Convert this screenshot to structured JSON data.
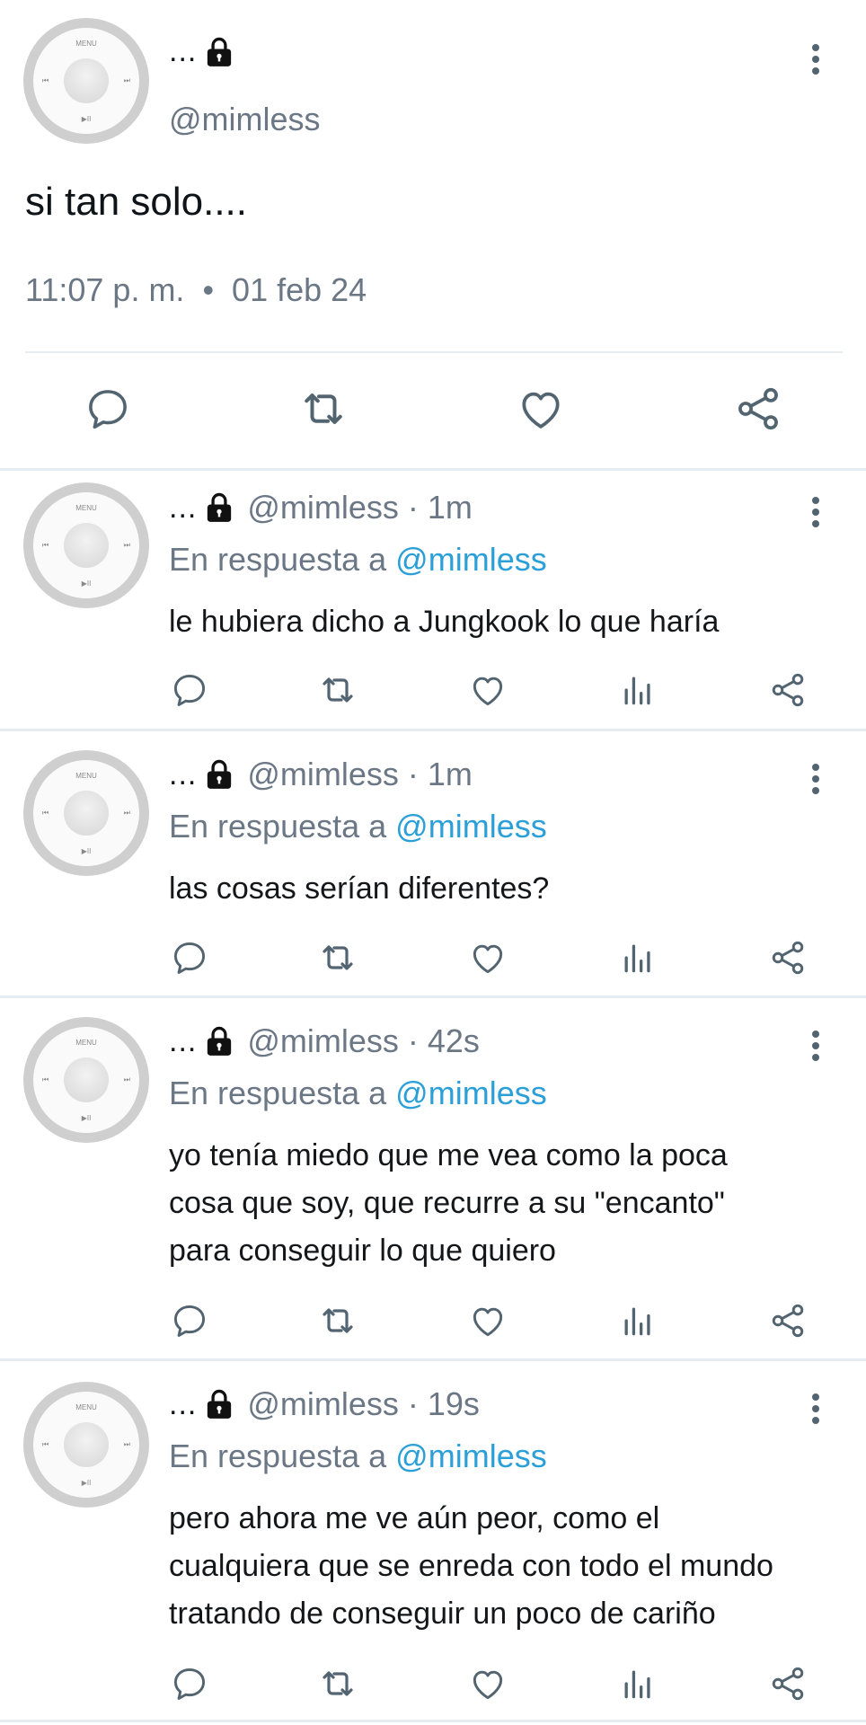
{
  "avatar_labels": {
    "menu": "MENU",
    "prev": "⏮",
    "next": "⏭",
    "play": "▶II"
  },
  "main_tweet": {
    "name": "...",
    "handle": "@mimless",
    "text": "si tan solo....",
    "time": "11:07 p. m.",
    "separator": "•",
    "date": "01 feb 24"
  },
  "replies": [
    {
      "name": "...",
      "handle_meta": "@mimless · 1m",
      "reply_prefix": "En respuesta a",
      "reply_to": "@mimless",
      "lines": [
        "le hubiera dicho a Jungkook lo que haría"
      ]
    },
    {
      "name": "...",
      "handle_meta": "@mimless · 1m",
      "reply_prefix": "En respuesta a",
      "reply_to": "@mimless",
      "lines": [
        "las cosas serían diferentes?"
      ]
    },
    {
      "name": "...",
      "handle_meta": "@mimless · 42s",
      "reply_prefix": "En respuesta a",
      "reply_to": "@mimless",
      "lines": [
        "yo tenía miedo que me vea como la poca",
        "cosa que soy, que recurre a su \"encanto\"",
        "para conseguir lo que quiero"
      ]
    },
    {
      "name": "...",
      "handle_meta": "@mimless · 19s",
      "reply_prefix": "En respuesta a",
      "reply_to": "@mimless",
      "lines": [
        "pero ahora me ve aún peor, como el",
        "cualquiera que se enreda con todo el mundo",
        "tratando de conseguir un poco de cariño"
      ]
    }
  ],
  "icons": {
    "lock": "lock-icon",
    "more": "more-vertical-icon",
    "reply": "reply-icon",
    "retweet": "retweet-icon",
    "like": "heart-icon",
    "views": "views-icon",
    "share": "share-icon"
  },
  "colors": {
    "text": "#0f1419",
    "muted": "#6b7785",
    "mention": "#2b9fd8",
    "icon": "#536471",
    "divider": "#e6ecf0"
  }
}
